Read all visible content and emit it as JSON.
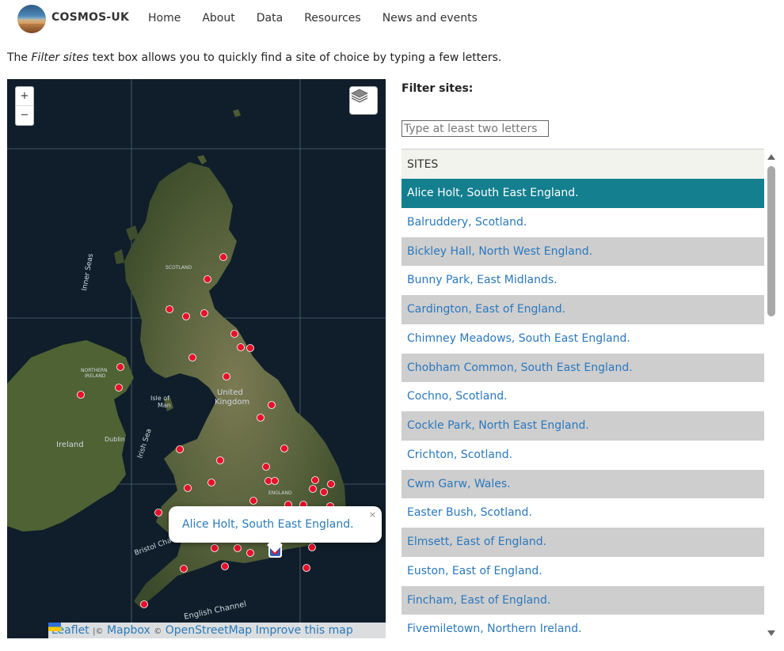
{
  "header": {
    "brand": "COSMOS-UK",
    "nav": [
      "Home",
      "About",
      "Data",
      "Resources",
      "News and events"
    ]
  },
  "intro": {
    "before": "The ",
    "emphasis": "Filter sites",
    "after": " text box allows you to quickly find a site of choice by typing a few letters."
  },
  "map": {
    "zoom_in": "+",
    "zoom_out": "−",
    "labels": {
      "inner_seas": "Inner Seas",
      "scotland": "SCOTLAND",
      "northern_ireland_1": "NORTHERN",
      "northern_ireland_2": "IRELAND",
      "isle_of_man_1": "Isle of",
      "isle_of_man_2": "Man",
      "uk_1": "United",
      "uk_2": "Kingdom",
      "irish_sea": "Irish Sea",
      "ireland": "Ireland",
      "dublin": "Dublin",
      "england": "ENGLAND",
      "bristol_channel": "Bristol Cha",
      "english_channel": "English Channel"
    },
    "popup": {
      "text": "Alice Holt, South East England.",
      "close": "×"
    },
    "attribution": {
      "leaflet": "Leaflet",
      "mapbox": "Mapbox",
      "osm": "OpenStreetMap",
      "improve": "Improve this map"
    }
  },
  "filter": {
    "label": "Filter sites:",
    "placeholder": "Type at least two letters"
  },
  "sites": {
    "header": "SITES",
    "items": [
      "Alice Holt, South East England.",
      "Balruddery, Scotland.",
      "Bickley Hall, North West England.",
      "Bunny Park, East Midlands.",
      "Cardington, East of England.",
      "Chimney Meadows, South East England.",
      "Chobham Common, South East England.",
      "Cochno, Scotland.",
      "Cockle Park, North East England.",
      "Crichton, Scotland.",
      "Cwm Garw, Wales.",
      "Easter Bush, Scotland.",
      "Elmsett, East of England.",
      "Euston, East of England.",
      "Fincham, East of England.",
      "Fivemiletown, Northern Ireland."
    ],
    "selected": "Alice Holt, South East England."
  },
  "colors": {
    "selected_row": "#137f8f",
    "alt_row": "#cecece",
    "link": "#2a78bd",
    "site_marker": "#e8102a"
  }
}
